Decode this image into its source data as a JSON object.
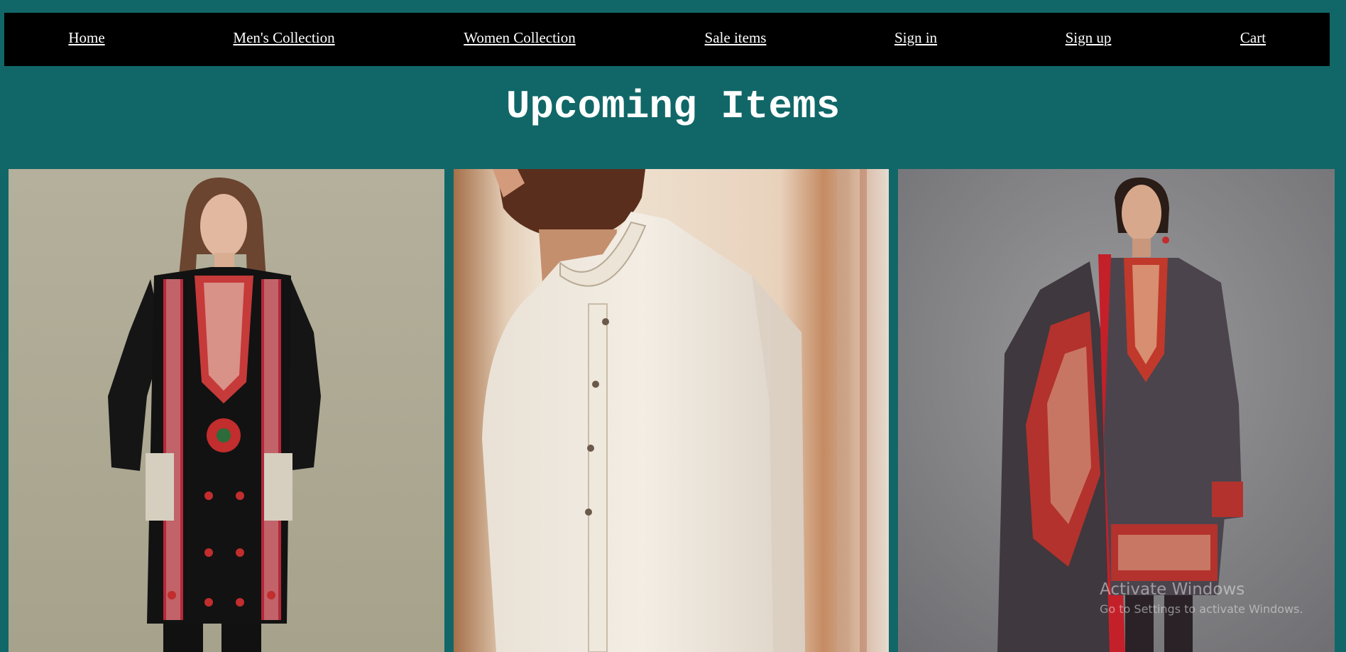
{
  "nav": {
    "items": [
      {
        "label": "Home"
      },
      {
        "label": "Men's Collection"
      },
      {
        "label": "Women Collection"
      },
      {
        "label": "Sale items"
      },
      {
        "label": "Sign in"
      },
      {
        "label": "Sign up"
      },
      {
        "label": "Cart"
      }
    ]
  },
  "page_title": "Upcoming Items",
  "products": [
    {
      "subject": "woman in black embroidered kurta with red patterns"
    },
    {
      "subject": "man in cream kurta with mandarin collar"
    },
    {
      "subject": "woman in grey printed suit with red patterned shawl"
    }
  ],
  "watermark": {
    "title": "Activate Windows",
    "subtitle": "Go to Settings to activate Windows."
  },
  "colors": {
    "background": "#116767",
    "navbar": "#000000",
    "text": "#ffffff"
  }
}
